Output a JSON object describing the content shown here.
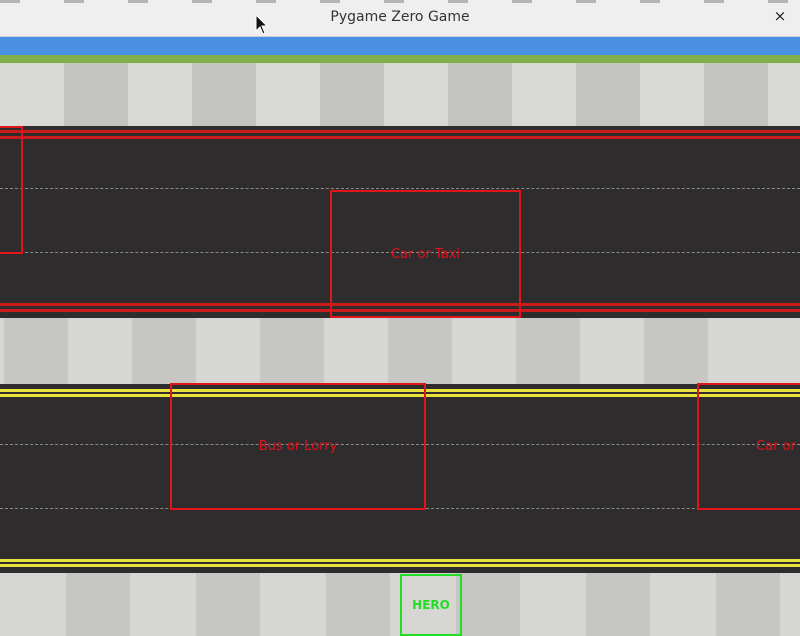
{
  "window": {
    "title": "Pygame Zero Game",
    "close_icon": "close-icon",
    "close_glyph": "×"
  },
  "colors": {
    "sky": "#4a90e2",
    "grass": "#7fb04c",
    "road": "#2f2c2d",
    "vehicle_outline": "#e0141b",
    "hero_outline": "#22dd22",
    "red_edge": "#cc1b1b",
    "yellow_edge": "#e8e23a"
  },
  "scene": {
    "vehicles": [
      {
        "label": ""
      },
      {
        "label": "Car or Taxi"
      },
      {
        "label": "Bus or Lorry"
      },
      {
        "label": "Car or Taxi"
      }
    ],
    "hero": {
      "label": "HERO"
    }
  }
}
